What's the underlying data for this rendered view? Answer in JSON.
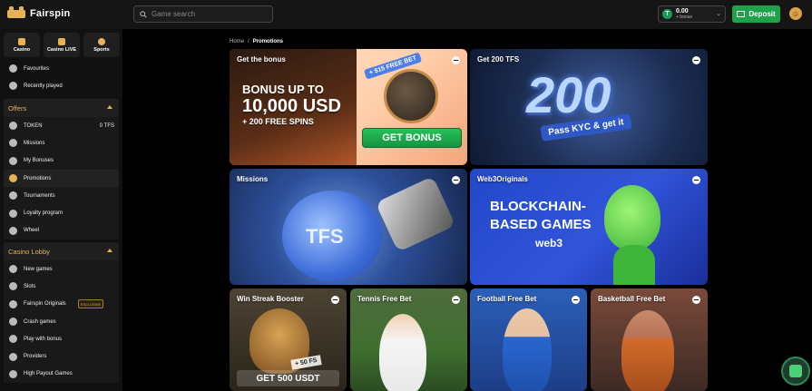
{
  "header": {
    "brand": "Fairspin",
    "search_placeholder": "Game search",
    "balance_amount": "0.00",
    "balance_sub": "+ bonus",
    "balance_currency_symbol": "T",
    "deposit_label": "Deposit"
  },
  "sidebar": {
    "categories": [
      {
        "label": "Casino",
        "icon": "casino-icon"
      },
      {
        "label": "Casino LIVE",
        "icon": "casino-live-icon"
      },
      {
        "label": "Sports",
        "icon": "sports-icon"
      }
    ],
    "top_items": [
      {
        "label": "Favourites",
        "icon": "heart-icon"
      },
      {
        "label": "Recently played",
        "icon": "clock-icon"
      }
    ],
    "offers_title": "Offers",
    "offers_items": [
      {
        "label": "TOKEN",
        "icon": "token-icon",
        "value": "0  TFS"
      },
      {
        "label": "Missions",
        "icon": "missions-icon"
      },
      {
        "label": "My Bonuses",
        "icon": "gift-icon"
      },
      {
        "label": "Promotions",
        "icon": "promotions-icon"
      },
      {
        "label": "Tournaments",
        "icon": "trophy-icon"
      },
      {
        "label": "Loyalty program",
        "icon": "loyalty-icon"
      },
      {
        "label": "Wheel",
        "icon": "wheel-icon"
      }
    ],
    "lobby_title": "Casino Lobby",
    "lobby_items": [
      {
        "label": "New games",
        "icon": "new-games-icon"
      },
      {
        "label": "Slots",
        "icon": "slots-icon"
      },
      {
        "label": "Fairspin Originals",
        "icon": "originals-icon",
        "badge": "EXCLUSIVE"
      },
      {
        "label": "Crash games",
        "icon": "crash-icon"
      },
      {
        "label": "Play with bonus",
        "icon": "bonus-icon"
      },
      {
        "label": "Providers",
        "icon": "providers-icon"
      },
      {
        "label": "High Payout Games",
        "icon": "payout-icon"
      }
    ]
  },
  "breadcrumb": {
    "home": "Home",
    "sep": "/",
    "current": "Promotions"
  },
  "promos": [
    {
      "title": "Get the bonus",
      "line1": "BONUS UP TO",
      "line2": "10,000 USD",
      "line3": "+ 200 FREE SPINS",
      "button": "GET BONUS",
      "tag": "+ $15 FREE BET"
    },
    {
      "title": "Get 200 TFS",
      "big": "200",
      "pill": "Pass KYC & get it"
    },
    {
      "title": "Missions",
      "coin": "TFS"
    },
    {
      "title": "Web3Originals",
      "line1": "BLOCKCHAIN-",
      "line1b": "BASED GAMES",
      "line2": "web3"
    },
    {
      "title": "Win Streak Booster",
      "tag": "+ 50 FS",
      "overlay": "GET 500 USDT"
    },
    {
      "title": "Tennis Free Bet"
    },
    {
      "title": "Football Free Bet"
    },
    {
      "title": "Basketball Free Bet"
    }
  ]
}
